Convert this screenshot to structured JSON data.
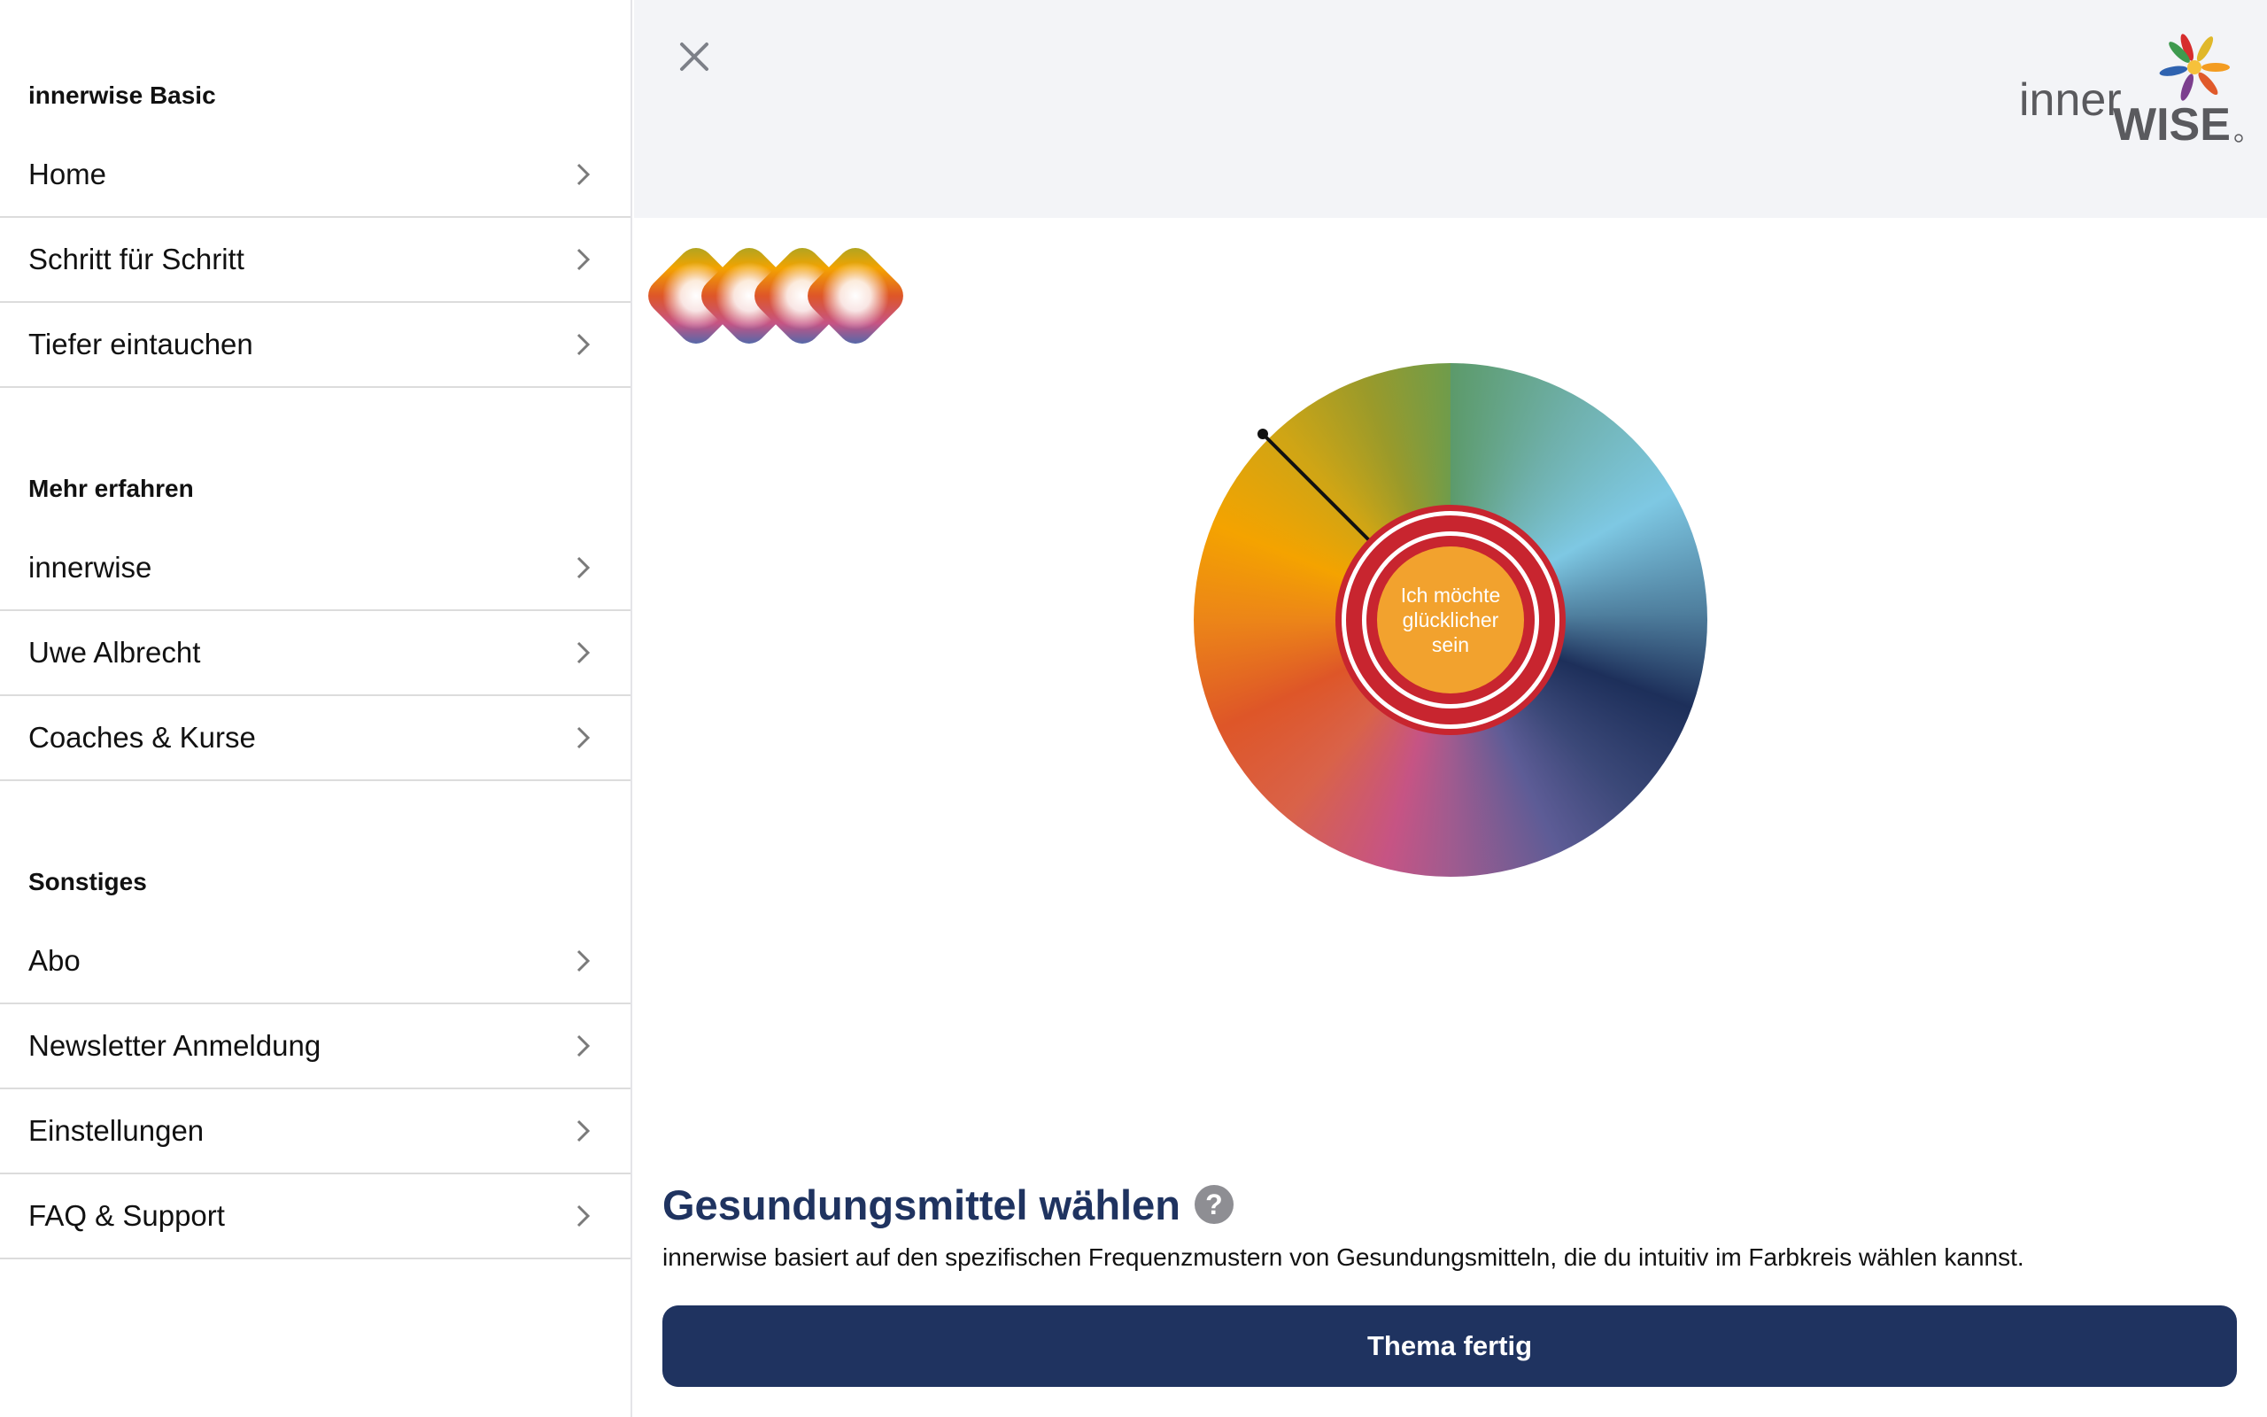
{
  "sidebar": {
    "sections": [
      {
        "heading": "innerwise Basic",
        "items": [
          {
            "label": "Home"
          },
          {
            "label": "Schritt für Schritt"
          },
          {
            "label": "Tiefer eintauchen"
          }
        ]
      },
      {
        "heading": "Mehr erfahren",
        "items": [
          {
            "label": "innerwise"
          },
          {
            "label": "Uwe Albrecht"
          },
          {
            "label": "Coaches & Kurse"
          }
        ]
      },
      {
        "heading": "Sonstiges",
        "items": [
          {
            "label": "Abo"
          },
          {
            "label": "Newsletter Anmeldung"
          },
          {
            "label": "Einstellungen"
          },
          {
            "label": "FAQ & Support"
          }
        ]
      }
    ]
  },
  "header": {
    "close_icon": "close-icon",
    "logo": {
      "word1": "inner",
      "word2": "WISE"
    }
  },
  "wheel": {
    "center_text": "Ich möchte glücklicher sein"
  },
  "content": {
    "title": "Gesundungsmittel wählen",
    "help_label": "?",
    "description": "innerwise basiert auf den spezifischen Frequenzmustern von Gesundungsmitteln, die du intuitiv im Farbkreis wählen kannst.",
    "primary_button": "Thema fertig"
  },
  "colors": {
    "navy": "#1f3360",
    "accent_red": "#c8252f",
    "core_orange": "#f2a22e",
    "topbar_bg": "#f3f4f7"
  }
}
